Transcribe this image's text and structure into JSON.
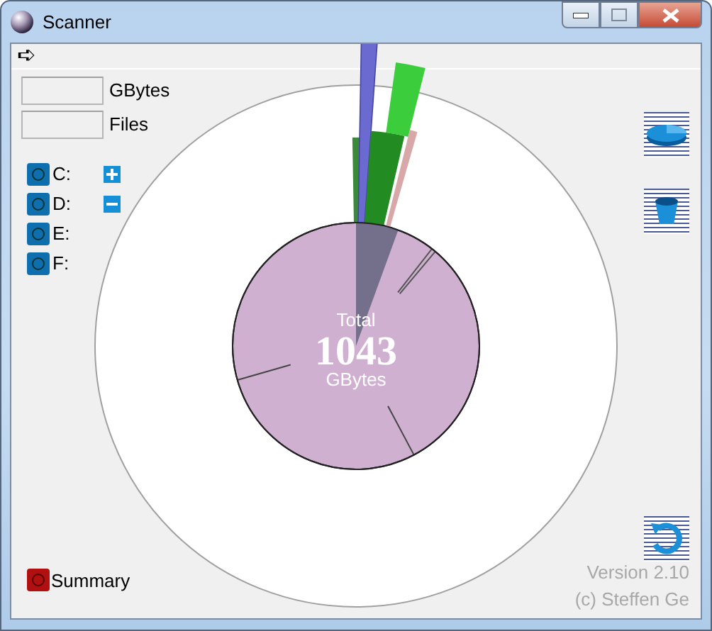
{
  "window": {
    "title": "Scanner"
  },
  "toolbar": {
    "arrow": "➪"
  },
  "fields": [
    {
      "label": "GBytes"
    },
    {
      "label": "Files"
    }
  ],
  "drives": [
    {
      "label": "C:",
      "kind": "expandable"
    },
    {
      "label": "D:",
      "kind": "collapsible"
    },
    {
      "label": "E:",
      "kind": "plain"
    },
    {
      "label": "F:",
      "kind": "plain"
    }
  ],
  "chart": {
    "caption": "Total",
    "value": "1043",
    "unit": "GBytes"
  },
  "summary": {
    "label": "Summary"
  },
  "footer": {
    "version": "Version 2.10",
    "copyright": "(c) Steffen Ge"
  }
}
